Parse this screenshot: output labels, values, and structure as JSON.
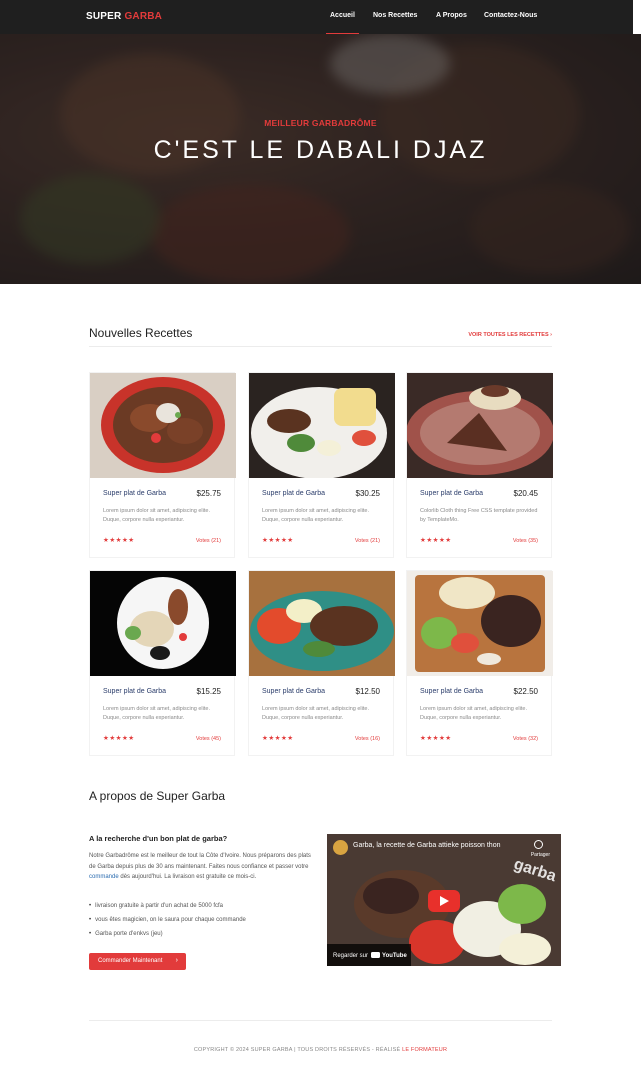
{
  "navbar": {
    "brand_first": "SUPER",
    "brand_second": "GARBA",
    "items": [
      {
        "label": "Accueil",
        "active": true
      },
      {
        "label": "Nos Recettes",
        "active": false
      },
      {
        "label": "A Propos",
        "active": false
      },
      {
        "label": "Contactez-Nous",
        "active": false
      }
    ]
  },
  "hero": {
    "kicker": "MEILLEUR GARBADRÔME",
    "title": "C'EST LE DABALI DJAZ"
  },
  "recipes": {
    "heading": "Nouvelles Recettes",
    "see_all": "VOIR TOUTES LES RECETTES ›",
    "cards": [
      {
        "name": "Super plat de Garba",
        "price": "$25.75",
        "description": "Lorem ipsum dolor sit amet, adipiscing elite. Duque, corpore nulla experiantur.",
        "stars": "★★★★★",
        "votes": "Votes (21)",
        "image": "garba-bowl-photo"
      },
      {
        "name": "Super plat de Garba",
        "price": "$30.25",
        "description": "Lorem ipsum dolor sit amet, adipiscing elite. Duque, corpore nulla experiantur.",
        "stars": "★★★★★",
        "votes": "Votes (21)",
        "image": "attieke-plate-photo"
      },
      {
        "name": "Super plat de Garba",
        "price": "$20.45",
        "description": "Colorlib Cloth thing Free CSS template provided by TemplateMo.",
        "stars": "★★★★★",
        "votes": "Votes (35)",
        "image": "fish-attieke-photo"
      },
      {
        "name": "Super plat de Garba",
        "price": "$15.25",
        "description": "Lorem ipsum dolor sit amet, adipiscing elite. Duque, corpore nulla experiantur.",
        "stars": "★★★★★",
        "votes": "Votes (45)",
        "image": "dark-plate-photo"
      },
      {
        "name": "Super plat de Garba",
        "price": "$12.50",
        "description": "Lorem ipsum dolor sit amet, adipiscing elite. Duque, corpore nulla experiantur.",
        "stars": "★★★★★",
        "votes": "Votes (16)",
        "image": "grilled-meat-photo"
      },
      {
        "name": "Super plat de Garba",
        "price": "$22.50",
        "description": "Lorem ipsum dolor sit amet, adipiscing elite. Duque, corpore nulla experiantur.",
        "stars": "★★★★★",
        "votes": "Votes (32)",
        "image": "wooden-board-photo"
      }
    ]
  },
  "about": {
    "heading": "A propos de Super Garba",
    "subheading": "A la recherche d'un bon plat de garba?",
    "para_before": "Notre Garbadrôme est le meilleur de tout la Côte d'Ivoire. Nous préparons des plats de Garba depuis plus de 30 ans maintenant. Faites nous confiance et passer votre ",
    "para_link": "commande",
    "para_after": " dès aujourd'hui. La livraison est gratuite ce mois-ci.",
    "bullets": [
      "livraison gratuite à partir d'un achat de 5000 fcfa",
      "vous êtes magicien, on le saura pour chaque commande",
      "Garba porte d'enkvs (jeu)"
    ],
    "button_label": "Commander Maintenant",
    "button_arrow": "›"
  },
  "video": {
    "title": "Garba, la recette de Garba attieke poisson thon",
    "share_label": "Partager",
    "watermark": "garba",
    "watch_label": "Regarder sur",
    "watch_brand": "YouTube"
  },
  "footer": {
    "copyright": "COPYRIGHT © 2024 SUPER GARBA | TOUS DROITS RÉSERVÉS - RÉALISÉ",
    "author": "LE FORMATEUR"
  },
  "colors": {
    "accent": "#e23b3b",
    "navbar": "#1f1f1f",
    "link": "#2b6cb0"
  }
}
